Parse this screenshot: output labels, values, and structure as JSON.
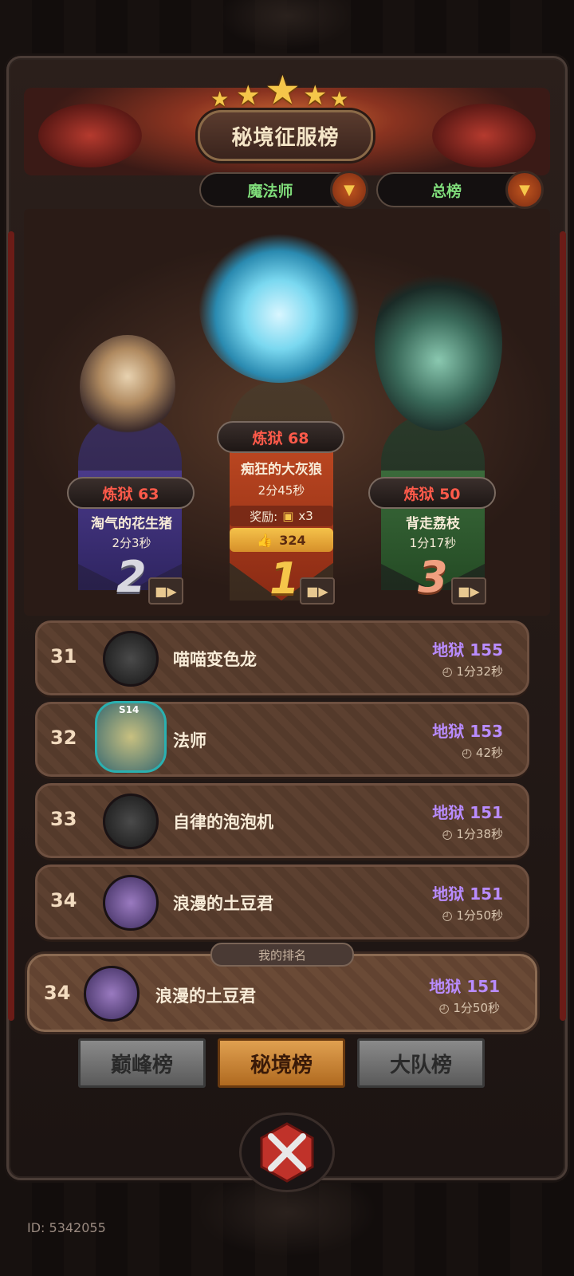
{
  "header": {
    "title": "秘境征服榜"
  },
  "filters": {
    "class_select": "魔法师",
    "scope_select": "总榜"
  },
  "podium": [
    {
      "rank": "2",
      "level": "炼狱 63",
      "name": "淘气的花生猪",
      "time": "2分3秒"
    },
    {
      "rank": "1",
      "level": "炼狱 68",
      "name": "痴狂的大灰狼",
      "time": "2分45秒",
      "reward_label": "奖励:",
      "reward_count": "x3",
      "likes": "324"
    },
    {
      "rank": "3",
      "level": "炼狱 50",
      "name": "背走荔枝",
      "time": "1分17秒"
    }
  ],
  "list": [
    {
      "rank": "31",
      "name": "喵喵变色龙",
      "level": "地狱 155",
      "time": "1分32秒"
    },
    {
      "rank": "32",
      "name": "法师",
      "level": "地狱 153",
      "time": "42秒",
      "badge": "S14"
    },
    {
      "rank": "33",
      "name": "自律的泡泡机",
      "level": "地狱 151",
      "time": "1分38秒"
    },
    {
      "rank": "34",
      "name": "浪漫的土豆君",
      "level": "地狱 151",
      "time": "1分50秒"
    }
  ],
  "my_rank": {
    "label": "我的排名",
    "rank": "34",
    "name": "浪漫的土豆君",
    "level": "地狱 151",
    "time": "1分50秒"
  },
  "tabs": [
    {
      "label": "巅峰榜"
    },
    {
      "label": "秘境榜"
    },
    {
      "label": "大队榜"
    }
  ],
  "footer": {
    "id_text": "ID: 5342055"
  },
  "colors": {
    "level_red": "#ff5a4a",
    "level_purple": "#b98cff",
    "accent_gold": "#f5c64a",
    "class_green": "#7fdc7a"
  }
}
